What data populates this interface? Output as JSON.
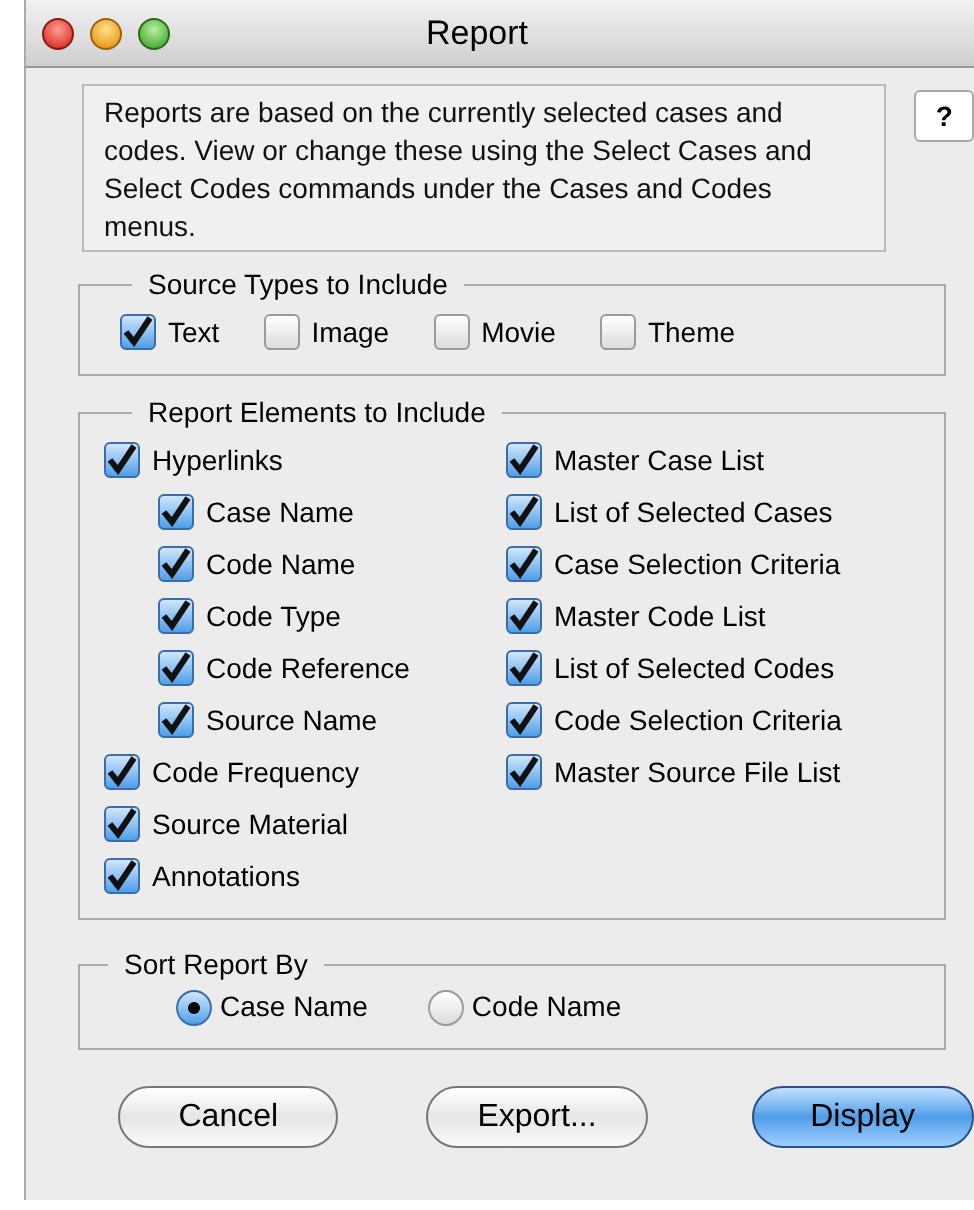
{
  "window": {
    "title": "Report"
  },
  "help_button": "?",
  "description": "Reports are based on the currently selected cases and codes.  View or change these using the Select Cases and Select Codes commands under the Cases and Codes menus.",
  "source_types": {
    "title": "Source Types to Include",
    "items": [
      {
        "label": "Text",
        "checked": true
      },
      {
        "label": "Image",
        "checked": false
      },
      {
        "label": "Movie",
        "checked": false
      },
      {
        "label": "Theme",
        "checked": false
      }
    ]
  },
  "report_elements": {
    "title": "Report Elements to Include",
    "column_1": [
      {
        "label": "Hyperlinks",
        "checked": true,
        "children": [
          {
            "label": "Case Name",
            "checked": true
          },
          {
            "label": "Code Name",
            "checked": true
          },
          {
            "label": "Code Type",
            "checked": true
          },
          {
            "label": "Code Reference",
            "checked": true
          },
          {
            "label": "Source Name",
            "checked": true
          }
        ]
      },
      {
        "label": "Code Frequency",
        "checked": true
      },
      {
        "label": "Source Material",
        "checked": true
      },
      {
        "label": "Annotations",
        "checked": true
      }
    ],
    "column_2": [
      {
        "label": "Master Case List",
        "checked": true
      },
      {
        "label": "List of Selected Cases",
        "checked": true
      },
      {
        "label": "Case Selection Criteria",
        "checked": true
      },
      {
        "label": "Master Code List",
        "checked": true
      },
      {
        "label": "List of Selected Codes",
        "checked": true
      },
      {
        "label": "Code Selection Criteria",
        "checked": true
      },
      {
        "label": "Master Source File List",
        "checked": true
      }
    ]
  },
  "sort_by": {
    "title": "Sort Report By",
    "options": [
      {
        "label": "Case Name",
        "selected": true
      },
      {
        "label": "Code Name",
        "selected": false
      }
    ]
  },
  "buttons": [
    {
      "label": "Cancel",
      "kind": "normal"
    },
    {
      "label": "Export...",
      "kind": "normal"
    },
    {
      "label": "Display",
      "kind": "default"
    }
  ]
}
